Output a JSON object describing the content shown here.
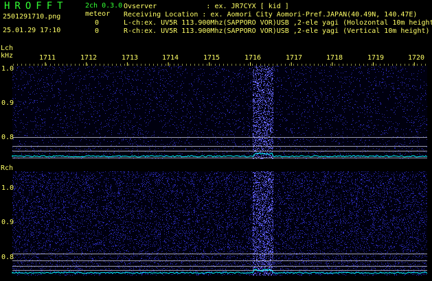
{
  "header": {
    "app_title": "HROFFT",
    "version": "2ch 0.3.0",
    "filename": "2501291710.png",
    "datetime": "25.01.29 17:10",
    "meteor_label": "meteor",
    "meteor_count_l": "0",
    "meteor_count_r": "0",
    "observer": "Ovserver            : ex. JR7CYX [ kid ]",
    "location": "Receiving Location : ex. Aomori City Aomori-Pref.JAPAN(40.49N, 140.47E)",
    "lch_info": "L-ch:ex. UV5R 113.900Mhz(SAPPORO VOR)USB ,2-ele yagi (Holozontal 10m height)",
    "rch_info": "R-ch:ex. UV5R 113.900Mhz(SAPPORO VOR)USB ,2-ele yagi (Vertical 10m height)"
  },
  "channels": {
    "lch_label": "Lch",
    "khz_label": "kHz",
    "rch_label": "Rch"
  },
  "time_ticks": [
    "1711",
    "1712",
    "1713",
    "1714",
    "1715",
    "1716",
    "1717",
    "1718",
    "1719",
    "1720"
  ],
  "y_labels_l": [
    "1.0",
    "0.9",
    "0.8"
  ],
  "y_labels_r": [
    "1.0",
    "0.9",
    "0.8"
  ],
  "colors": {
    "background": "#000000",
    "text": "#ffff66",
    "title": "#33ff33",
    "spectrum_noise": "#2a2ab4",
    "meteor_band": "#6a6aff",
    "level_line": "#a0a0b0",
    "level_trace": "#00ffff"
  }
}
